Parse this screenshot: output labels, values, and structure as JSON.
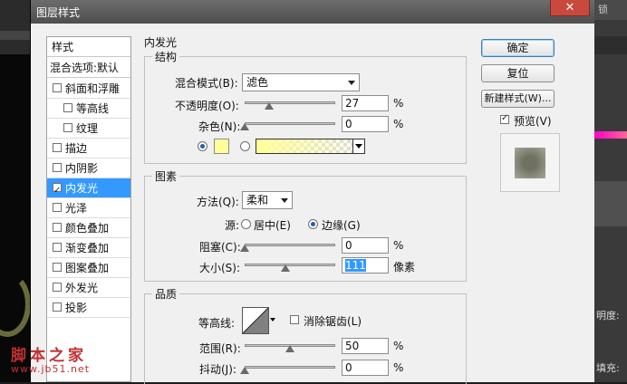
{
  "dialog": {
    "title": "图层样式",
    "close": "✕"
  },
  "style_list": {
    "header": "样式",
    "blend_options": "混合选项:默认",
    "items": [
      {
        "label": "斜面和浮雕",
        "checked": false
      },
      {
        "label": "等高线",
        "checked": false
      },
      {
        "label": "纹理",
        "checked": false
      },
      {
        "label": "描边",
        "checked": false
      },
      {
        "label": "内阴影",
        "checked": false
      },
      {
        "label": "内发光",
        "checked": true,
        "selected": true
      },
      {
        "label": "光泽",
        "checked": false
      },
      {
        "label": "颜色叠加",
        "checked": false
      },
      {
        "label": "渐变叠加",
        "checked": false
      },
      {
        "label": "图案叠加",
        "checked": false
      },
      {
        "label": "外发光",
        "checked": false
      },
      {
        "label": "投影",
        "checked": false
      }
    ]
  },
  "panel": {
    "heading": "内发光",
    "structure": {
      "legend": "结构",
      "blend_mode_label": "混合模式(B):",
      "blend_mode_value": "滤色",
      "opacity_label": "不透明度(O):",
      "opacity_value": "27",
      "opacity_unit": "%",
      "noise_label": "杂色(N):",
      "noise_value": "0",
      "noise_unit": "%"
    },
    "elements": {
      "legend": "图素",
      "method_label": "方法(Q):",
      "method_value": "柔和",
      "source_label": "源:",
      "source_center": "居中(E)",
      "source_edge": "边缘(G)",
      "choke_label": "阻塞(C):",
      "choke_value": "0",
      "choke_unit": "%",
      "size_label": "大小(S):",
      "size_value": "111",
      "size_unit": "像素"
    },
    "quality": {
      "legend": "品质",
      "contour_label": "等高线:",
      "antialias_label": "消除锯齿(L)",
      "range_label": "范围(R):",
      "range_value": "50",
      "range_unit": "%",
      "jitter_label": "抖动(J):",
      "jitter_value": "0",
      "jitter_unit": "%"
    },
    "slider_levels": {
      "opacity": 0.27,
      "noise": 0,
      "choke": 0,
      "size": 0.44,
      "range": 0.5,
      "jitter": 0
    },
    "glow_color": "#ffff9a"
  },
  "buttons": {
    "ok": "确定",
    "reset": "复位",
    "new_style": "新建样式(W)...",
    "preview": "预览(V)"
  },
  "background_app": {
    "right_texts": [
      "锁",
      "填充:",
      "明度:"
    ]
  },
  "watermark": {
    "title": "脚本之家",
    "url": "www.jb51.net"
  }
}
